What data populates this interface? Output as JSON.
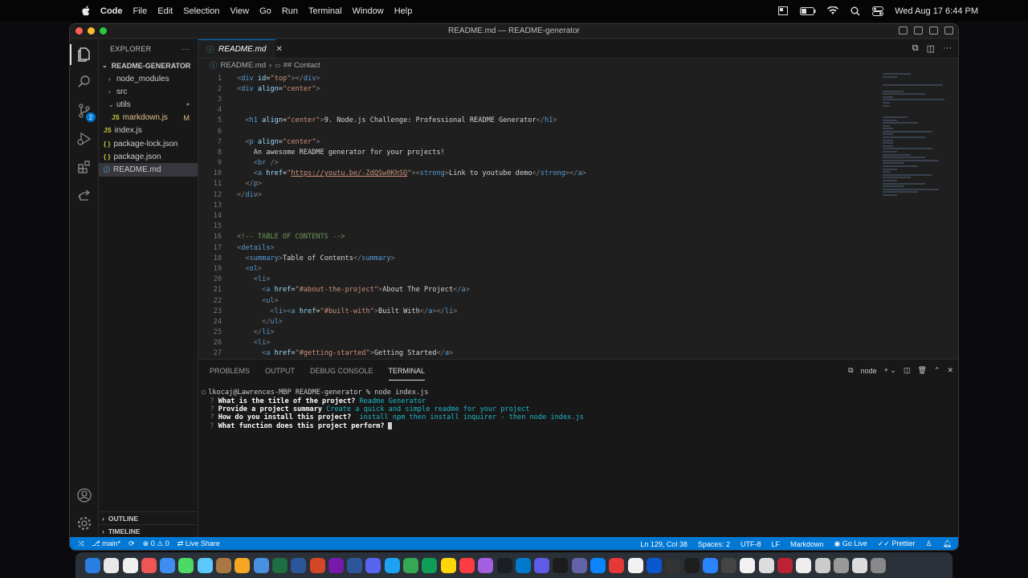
{
  "menubar": {
    "app_name": "Code",
    "items": [
      "File",
      "Edit",
      "Selection",
      "View",
      "Go",
      "Run",
      "Terminal",
      "Window",
      "Help"
    ],
    "clock": "Wed Aug 17  6:44 PM",
    "status_icons": [
      "display-icon",
      "battery-icon",
      "wifi-icon",
      "search-icon",
      "control-center-icon"
    ]
  },
  "window": {
    "title": "README.md — README-generator"
  },
  "activitybar": {
    "source_control_badge": "2"
  },
  "explorer": {
    "header": "EXPLORER",
    "more": "···",
    "root": "README-GENERATOR",
    "items": [
      {
        "label": "node_modules",
        "kind": "folder",
        "expanded": false
      },
      {
        "label": "src",
        "kind": "folder",
        "expanded": false
      },
      {
        "label": "utils",
        "kind": "folder",
        "expanded": true,
        "git": "•"
      },
      {
        "label": "markdown.js",
        "kind": "js",
        "git": "M"
      },
      {
        "label": "index.js",
        "kind": "js"
      },
      {
        "label": "package-lock.json",
        "kind": "json"
      },
      {
        "label": "package.json",
        "kind": "json"
      },
      {
        "label": "README.md",
        "kind": "md",
        "selected": true
      }
    ],
    "outline": "OUTLINE",
    "timeline": "TIMELINE"
  },
  "editor": {
    "tab_label": "README.md",
    "breadcrumb_file": "README.md",
    "breadcrumb_symbol": "## Contact",
    "lines": [
      {
        "n": "1",
        "t": "<div id=\"top\"></div>"
      },
      {
        "n": "2",
        "t": "<div align=\"center\">"
      },
      {
        "n": "3",
        "t": ""
      },
      {
        "n": "4",
        "t": ""
      },
      {
        "n": "5",
        "t": "  <h1 align=\"center\">9. Node.js Challenge: Professional README Generator</h1>"
      },
      {
        "n": "6",
        "t": ""
      },
      {
        "n": "7",
        "t": "  <p align=\"center\">"
      },
      {
        "n": "8",
        "t": "    An awesome README generator for your projects!"
      },
      {
        "n": "9",
        "t": "    <br />"
      },
      {
        "n": "10",
        "t": "    <a href=\"https://youtu.be/-ZdQSw0KhSQ\"><strong>Link to youtube demo</strong></a>"
      },
      {
        "n": "11",
        "t": "  </p>"
      },
      {
        "n": "12",
        "t": "</div>"
      },
      {
        "n": "13",
        "t": ""
      },
      {
        "n": "14",
        "t": ""
      },
      {
        "n": "15",
        "t": ""
      },
      {
        "n": "16",
        "t": "<!-- TABLE OF CONTENTS -->"
      },
      {
        "n": "17",
        "t": "<details>"
      },
      {
        "n": "18",
        "t": "  <summary>Table of Contents</summary>"
      },
      {
        "n": "19",
        "t": "  <ol>"
      },
      {
        "n": "20",
        "t": "    <li>"
      },
      {
        "n": "21",
        "t": "      <a href=\"#about-the-project\">About The Project</a>"
      },
      {
        "n": "22",
        "t": "      <ul>"
      },
      {
        "n": "23",
        "t": "        <li><a href=\"#built-with\">Built With</a></li>"
      },
      {
        "n": "24",
        "t": "      </ul>"
      },
      {
        "n": "25",
        "t": "    </li>"
      },
      {
        "n": "26",
        "t": "    <li>"
      },
      {
        "n": "27",
        "t": "      <a href=\"#getting-started\">Getting Started</a>"
      }
    ]
  },
  "panel": {
    "tabs": [
      "PROBLEMS",
      "OUTPUT",
      "DEBUG CONSOLE",
      "TERMINAL"
    ],
    "active_tab": "TERMINAL",
    "shell": "node",
    "terminal": {
      "prompt": "lkocaj@Lawrences-MBP README-generator % node index.js",
      "qa": [
        {
          "q": "What is the title of the project?",
          "a": "Readme Generator"
        },
        {
          "q": "Provide a project summary",
          "a": "Create a quick and simple readme for your project"
        },
        {
          "q": "How do you install this project?",
          "a": " install npm then install inquirer - then node index.js"
        },
        {
          "q": "What function does this project perform?",
          "a": ""
        }
      ]
    }
  },
  "statusbar": {
    "branch": "main*",
    "problems": "0",
    "warnings": "0",
    "live_share": "Live Share",
    "position": "Ln 129, Col 38",
    "spaces": "Spaces: 2",
    "encoding": "UTF-8",
    "eol": "LF",
    "language": "Markdown",
    "go_live": "Go Live",
    "prettier": "Prettier"
  }
}
